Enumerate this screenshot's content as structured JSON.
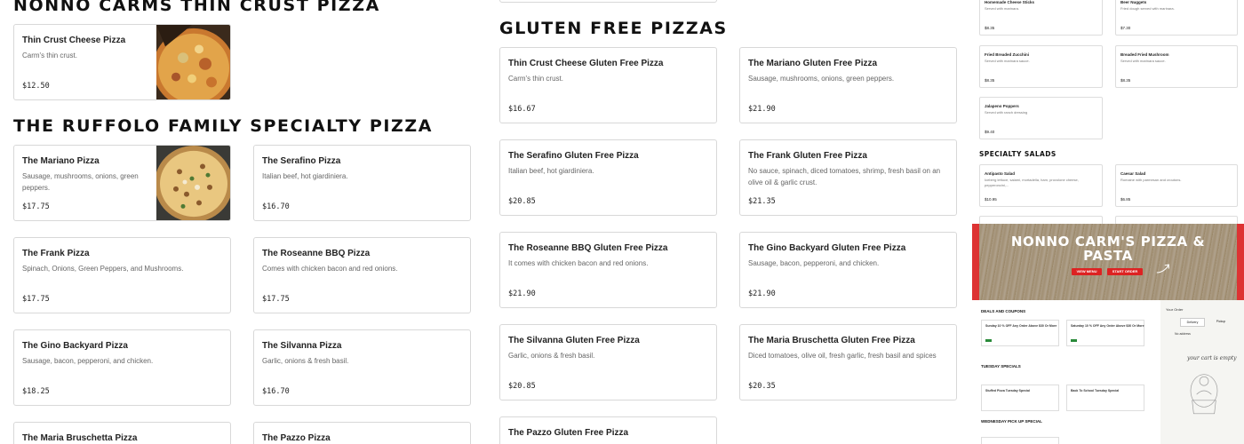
{
  "sections": {
    "classic_title": "NONNO CARMS THIN CRUST PIZZA",
    "specialty_title": "THE RUFFOLO FAMILY SPECIALTY PIZZA",
    "gluten_title": "GLUTEN FREE PIZZAS"
  },
  "classic": [
    {
      "name": "Thin Crust Cheese Pizza",
      "desc": "Carm's thin crust.",
      "price": "$12.50"
    }
  ],
  "specialty": [
    {
      "name": "The Mariano Pizza",
      "desc": "Sausage, mushrooms, onions, green peppers.",
      "price": "$17.75"
    },
    {
      "name": "The Serafino Pizza",
      "desc": "Italian beef, hot giardiniera.",
      "price": "$16.70"
    },
    {
      "name": "The Frank Pizza",
      "desc": "Spinach, Onions, Green Peppers, and Mushrooms.",
      "price": "$17.75"
    },
    {
      "name": "The Roseanne BBQ Pizza",
      "desc": "Comes with chicken bacon and red onions.",
      "price": "$17.75"
    },
    {
      "name": "The Gino Backyard Pizza",
      "desc": "Sausage, bacon, pepperoni, and chicken.",
      "price": "$18.25"
    },
    {
      "name": "The Silvanna Pizza",
      "desc": "Garlic, onions & fresh basil.",
      "price": "$16.70"
    },
    {
      "name": "The Maria Bruschetta Pizza",
      "desc": "",
      "price": ""
    },
    {
      "name": "The Pazzo Pizza",
      "desc": "",
      "price": ""
    }
  ],
  "gluten": [
    {
      "name": "Thin Crust Cheese Gluten Free Pizza",
      "desc": "Carm's thin crust.",
      "price": "$16.67"
    },
    {
      "name": "The Mariano Gluten Free Pizza",
      "desc": "Sausage, mushrooms, onions, green peppers.",
      "price": "$21.90"
    },
    {
      "name": "The Serafino Gluten Free Pizza",
      "desc": "Italian beef, hot giardiniera.",
      "price": "$20.85"
    },
    {
      "name": "The Frank Gluten Free Pizza",
      "desc": "No sauce, spinach, diced tomatoes, shrimp, fresh basil on an olive oil & garlic crust.",
      "price": "$21.35"
    },
    {
      "name": "The Roseanne BBQ Gluten Free Pizza",
      "desc": "It comes with chicken bacon and red onions.",
      "price": "$21.90"
    },
    {
      "name": "The Gino Backyard Gluten Free Pizza",
      "desc": "Sausage, bacon, pepperoni, and chicken.",
      "price": "$21.90"
    },
    {
      "name": "The Silvanna Gluten Free Pizza",
      "desc": "Garlic, onions & fresh basil.",
      "price": "$20.85"
    },
    {
      "name": "The Maria Bruschetta Gluten Free Pizza",
      "desc": "Diced tomatoes, olive oil, fresh garlic, fresh basil and spices",
      "price": "$20.35"
    },
    {
      "name": "The Pazzo Gluten Free Pizza",
      "desc": "",
      "price": ""
    }
  ],
  "mini_panel": {
    "items": [
      {
        "name": "Homemade Cheese Sticks",
        "desc": "Served with marinara.",
        "price": "$8.35"
      },
      {
        "name": "Beer Nuggets",
        "desc": "Fried dough served with marinara.",
        "price": "$7.30"
      },
      {
        "name": "Fried Breaded Zucchini",
        "desc": "Served with marinara sauce.",
        "price": "$8.35"
      },
      {
        "name": "Breaded Fried Mushroom",
        "desc": "Served with marinara sauce.",
        "price": "$8.35"
      },
      {
        "name": "Jalapeno Poppers",
        "desc": "Served with ranch dressing",
        "price": "$9.40"
      }
    ],
    "salads_title": "SPECIALTY SALADS",
    "salads": [
      {
        "name": "Antipasto Salad",
        "desc": "Iceberg lettuce, salami, mortadella, ham, provolone cheese, pepperoncini,...",
        "price": "$10.95"
      },
      {
        "name": "Caesar Salad",
        "desc": "Romaine with parmesan and croutons.",
        "price": "$6.85"
      }
    ]
  },
  "promo": {
    "title_line1": "NONNO CARM'S PIZZA &",
    "title_line2": "PASTA",
    "view_menu": "VIEW MENU",
    "start_order": "START ORDER",
    "deals_title": "DEALS AND COUPONS",
    "deal1": "Sunday 10 % OFF Any Order Above $30 Or More",
    "deal2": "Saturday 10 % OFF Any Order Above $30 Or More",
    "tuesday": "TUESDAY SPECIALS",
    "tue1": "Stuffed Pizza Tuesday Special",
    "tue2": "Back To School Tuesday Special",
    "wednesday": "WEDNESDAY PICK UP SPECIAL",
    "your_order": "Your Order",
    "delivery": "Delivery",
    "pickup": "Pickup",
    "no_address": "No address",
    "empty_cart": "your cart is empty"
  }
}
